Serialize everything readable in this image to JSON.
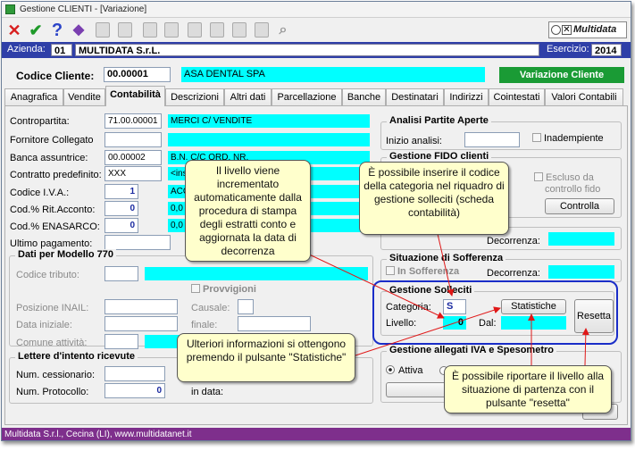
{
  "window": {
    "title": "Gestione CLIENTI - [Variazione]"
  },
  "toolbar": {
    "icons": [
      "cancel-icon",
      "confirm-icon",
      "help-icon",
      "wizard-icon",
      "print-icon",
      "delete-icon",
      "copy-icon",
      "paste-icon",
      "new-icon",
      "tools-icon",
      "check-icon",
      "notes-icon",
      "search-icon"
    ]
  },
  "logo": "Multidata",
  "header": {
    "azienda_label": "Azienda:",
    "azienda_code": "01",
    "azienda_name": "MULTIDATA S.r.L.",
    "esercizio_label": "Esercizio:",
    "esercizio_value": "2014"
  },
  "cliente": {
    "label": "Codice Cliente:",
    "code": "00.00001",
    "name": "ASA DENTAL SPA",
    "mode_button": "Variazione Cliente"
  },
  "tabs": [
    "Anagrafica",
    "Vendite",
    "Contabilità",
    "Descrizioni",
    "Altri dati",
    "Parcellazione",
    "Banche",
    "Destinatari",
    "Indirizzi",
    "Cointestati",
    "Valori Contabili"
  ],
  "form": {
    "contropartita_label": "Contropartita:",
    "contropartita_code": "71.00.00001",
    "contropartita_desc": "MERCI C/ VENDITE",
    "fornitore_label": "Fornitore Collegato",
    "banca_label": "Banca assuntrice:",
    "banca_code": "00.00002",
    "banca_desc": "B.N. C/C ORD. NR.",
    "contratto_label": "Contratto predefinito:",
    "contratto_code": "XXX",
    "contratto_desc": "<ins",
    "iva_label": "Codice I.V.A.:",
    "iva_value": "1",
    "iva_desc": "ACC",
    "rit_label": "Cod.% Rit.Acconto:",
    "rit_value": "0",
    "rit_desc": "0,0",
    "enasarco_label": "Cod.% ENASARCO:",
    "enasarco_value": "0",
    "enasarco_desc": "0,0",
    "ultimo_label": "Ultimo pagamento:"
  },
  "modello770": {
    "title": "Dati per Modello 770",
    "codice_tributo": "Codice tributo:",
    "provvigioni": "Provvigioni",
    "posizione_inail": "Posizione INAIL:",
    "causale": "Causale:",
    "data_iniziale": "Data iniziale:",
    "finale": "finale:",
    "comune": "Comune attività:"
  },
  "intento": {
    "title": "Lettere d'intento ricevute",
    "cessionario": "Num. cessionario:",
    "protocollo": "Num. Protocollo:",
    "protocollo_value": "0",
    "in_data": "in data:"
  },
  "partite": {
    "title": "Analisi Partite Aperte",
    "inizio": "Inizio analisi:",
    "inadempiente": "Inadempiente"
  },
  "fido": {
    "title": "Gestione FIDO clienti",
    "escluso_line1": "Escluso da",
    "escluso_line2": "controllo fido",
    "controlla_button": "Controlla",
    "decorrenza": "Decorrenza:"
  },
  "sofferenza": {
    "title": "Situazione di Sofferenza",
    "in_sofferenza": "In Sofferenza",
    "decorrenza": "Decorrenza:"
  },
  "solleciti": {
    "title": "Gestione Solleciti",
    "categoria_label": "Categoria:",
    "categoria_value": "S",
    "statistiche_button": "Statistiche",
    "livello_label": "Livello:",
    "livello_value": "0",
    "dal_label": "Dal:",
    "resetta_button": "Resetta"
  },
  "allegati": {
    "title": "Gestione allegati IVA e Spesometro",
    "attiva": "Attiva"
  },
  "status_bar": "Multidata S.r.l., Cecina (LI), www.multidatanet.it",
  "callouts": {
    "livello": "Il livello viene incrementato automaticamente dalla procedura di stampa degli estratti conto e aggiornata la data di decorrenza",
    "categoria": "È possibile inserire il codice della categoria nel riquadro di gestione solleciti (scheda contabilità)",
    "statistiche": "Ulteriori informazioni si ottengono premendo il pulsante \"Statistiche\"",
    "resetta": "È possibile riportare il livello alla situazione di partenza con il pulsante \"resetta\""
  }
}
